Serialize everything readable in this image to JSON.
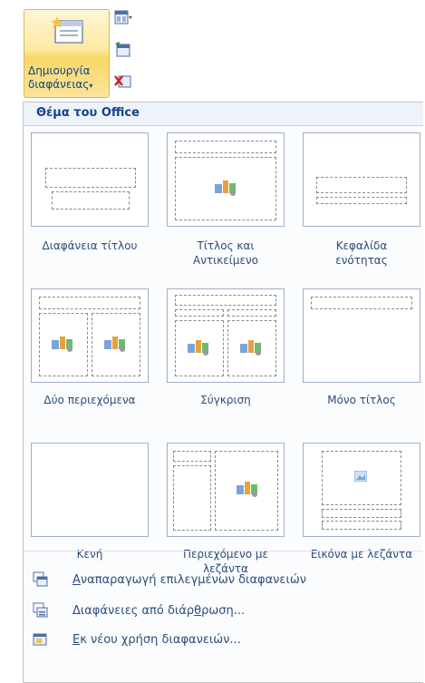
{
  "ribbon": {
    "new_slide_label_line1": "Δημιουργία",
    "new_slide_label_line2": "διαφάνειας",
    "new_slide_arrow": "▾"
  },
  "gallery": {
    "header": "Θέμα του Office",
    "layouts": [
      {
        "line1": "Διαφάνεια τίτλου",
        "line2": ""
      },
      {
        "line1": "Τίτλος και",
        "line2": "Αντικείμενο"
      },
      {
        "line1": "Κεφαλίδα",
        "line2": "ενότητας"
      },
      {
        "line1": "Δύο περιεχόμενα",
        "line2": ""
      },
      {
        "line1": "Σύγκριση",
        "line2": ""
      },
      {
        "line1": "Μόνο τίτλος",
        "line2": ""
      },
      {
        "line1": "Κενή",
        "line2": ""
      },
      {
        "line1": "Περιεχόμενο με",
        "line2": "λεζάντα"
      },
      {
        "line1": "Εικόνα με λεζάντα",
        "line2": ""
      }
    ]
  },
  "menu": {
    "duplicate": {
      "mnemonic": "Α",
      "rest": "ναπαραγωγή επιλεγμένων διαφανειών"
    },
    "outline": {
      "before": "Διαφάνειες από διάρ",
      "mnemonic": "θ",
      "after": "ρωση..."
    },
    "reuse": {
      "mnemonic": "Ε",
      "rest": "κ νέου χρήση διαφανειών..."
    }
  },
  "icons": [
    "new-slide-icon",
    "layout-icon",
    "reset-icon",
    "delete-icon",
    "content-icon",
    "picture-icon"
  ]
}
